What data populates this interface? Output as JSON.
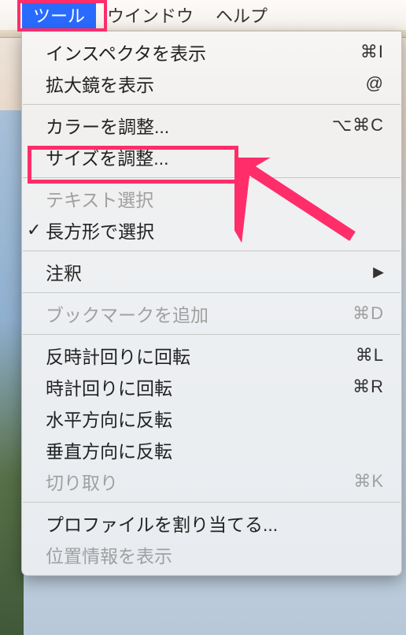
{
  "menubar": {
    "tools": "ツール",
    "window": "ウインドウ",
    "help": "ヘルプ"
  },
  "menu": {
    "show_inspector": {
      "label": "インスペクタを表示",
      "shortcut": "⌘I"
    },
    "show_magnifier": {
      "label": "拡大鏡を表示",
      "shortcut": "@"
    },
    "adjust_color": {
      "label": "カラーを調整...",
      "shortcut": "⌥⌘C"
    },
    "adjust_size": {
      "label": "サイズを調整..."
    },
    "text_selection": {
      "label": "テキスト選択"
    },
    "rect_selection": {
      "label": "長方形で選択"
    },
    "annotate": {
      "label": "注釈"
    },
    "add_bookmark": {
      "label": "ブックマークを追加",
      "shortcut": "⌘D"
    },
    "rotate_ccw": {
      "label": "反時計回りに回転",
      "shortcut": "⌘L"
    },
    "rotate_cw": {
      "label": "時計回りに回転",
      "shortcut": "⌘R"
    },
    "flip_horizontal": {
      "label": "水平方向に反転"
    },
    "flip_vertical": {
      "label": "垂直方向に反転"
    },
    "crop": {
      "label": "切り取り",
      "shortcut": "⌘K"
    },
    "assign_profile": {
      "label": "プロファイルを割り当てる..."
    },
    "show_location": {
      "label": "位置情報を表示"
    }
  }
}
